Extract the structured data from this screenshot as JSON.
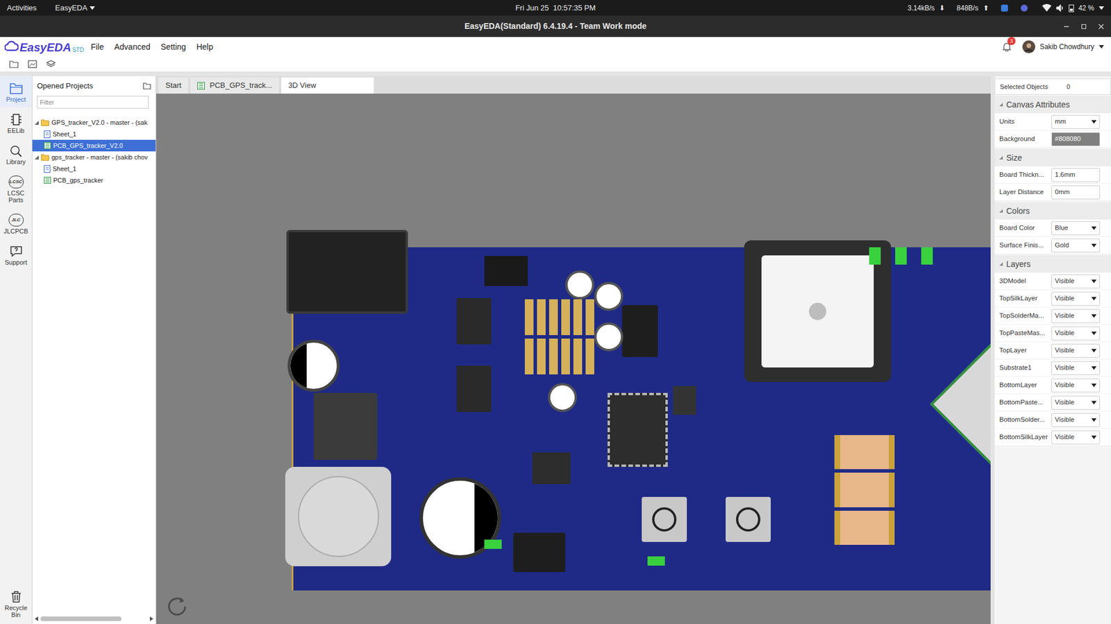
{
  "system_bar": {
    "activities": "Activities",
    "app_menu": "EasyEDA",
    "clock": "Fri Jun 25  10:57:35 PM",
    "download_rate": "3.14kB/s",
    "download_arrow": "⬇",
    "upload_rate": "848B/s",
    "upload_arrow": "⬆",
    "battery": "42 %"
  },
  "window": {
    "title": "EasyEDA(Standard) 6.4.19.4 - Team Work mode"
  },
  "app_bar": {
    "logo": "EasyEDA",
    "logo_suffix": "STD",
    "menus": [
      "File",
      "Advanced",
      "Setting",
      "Help"
    ],
    "notifications": "3",
    "user": "Sakib Chowdhury"
  },
  "sidebar": {
    "items": [
      {
        "label": "Project",
        "selected": true
      },
      {
        "label": "EELib",
        "selected": false
      },
      {
        "label": "Library",
        "selected": false
      },
      {
        "label": "LCSC Parts",
        "selected": false,
        "icon_text": "LCSC"
      },
      {
        "label": "JLCPCB",
        "selected": false,
        "icon_text": "JLC"
      },
      {
        "label": "Support",
        "selected": false
      }
    ],
    "recycle": "Recycle Bin"
  },
  "projects": {
    "title": "Opened Projects",
    "filter_placeholder": "Filter",
    "tree": [
      {
        "label": "GPS_tracker_V2.0 - master - (sak",
        "kind": "project",
        "depth": 0,
        "expanded": true,
        "selected": false
      },
      {
        "label": "Sheet_1",
        "kind": "schematic",
        "depth": 1,
        "selected": false
      },
      {
        "label": "PCB_GPS_tracker_V2.0",
        "kind": "pcb",
        "depth": 1,
        "selected": true
      },
      {
        "label": "gps_tracker - master - (sakib chov",
        "kind": "project",
        "depth": 0,
        "expanded": true,
        "selected": false
      },
      {
        "label": "Sheet_1",
        "kind": "schematic",
        "depth": 1,
        "selected": false
      },
      {
        "label": "PCB_gps_tracker",
        "kind": "pcb",
        "depth": 1,
        "selected": false
      }
    ]
  },
  "tabs": [
    {
      "label": "Start",
      "kind": "start",
      "selected": false
    },
    {
      "label": "PCB_GPS_track...",
      "kind": "pcb",
      "selected": false
    },
    {
      "label": "3D View",
      "kind": "plain",
      "selected": true
    }
  ],
  "properties": {
    "selected_label": "Selected Objects",
    "selected_count": "0",
    "sections": [
      {
        "title": "Canvas Attributes",
        "expanded": true,
        "rows": [
          {
            "label": "Units",
            "value": "mm",
            "kind": "select"
          },
          {
            "label": "Background",
            "value": "#808080",
            "kind": "color"
          }
        ]
      },
      {
        "title": "Size",
        "expanded": true,
        "rows": [
          {
            "label": "Board Thickn...",
            "value": "1.6mm",
            "kind": "input"
          },
          {
            "label": "Layer Distance",
            "value": "0mm",
            "kind": "input"
          }
        ]
      },
      {
        "title": "Colors",
        "expanded": true,
        "rows": [
          {
            "label": "Board Color",
            "value": "Blue",
            "kind": "select"
          },
          {
            "label": "Surface Finis...",
            "value": "Gold",
            "kind": "select"
          }
        ]
      },
      {
        "title": "Layers",
        "expanded": true,
        "rows": [
          {
            "label": "3DModel",
            "value": "Visible",
            "kind": "select"
          },
          {
            "label": "TopSilkLayer",
            "value": "Visible",
            "kind": "select"
          },
          {
            "label": "TopSolderMa...",
            "value": "Visible",
            "kind": "select"
          },
          {
            "label": "TopPasteMas...",
            "value": "Visible",
            "kind": "select"
          },
          {
            "label": "TopLayer",
            "value": "Visible",
            "kind": "select"
          },
          {
            "label": "Substrate1",
            "value": "Visible",
            "kind": "select"
          },
          {
            "label": "BottomLayer",
            "value": "Visible",
            "kind": "select"
          },
          {
            "label": "BottomPaste...",
            "value": "Visible",
            "kind": "select"
          },
          {
            "label": "BottomSolder...",
            "value": "Visible",
            "kind": "select"
          },
          {
            "label": "BottomSilkLayer",
            "value": "Visible",
            "kind": "select"
          }
        ]
      }
    ]
  }
}
